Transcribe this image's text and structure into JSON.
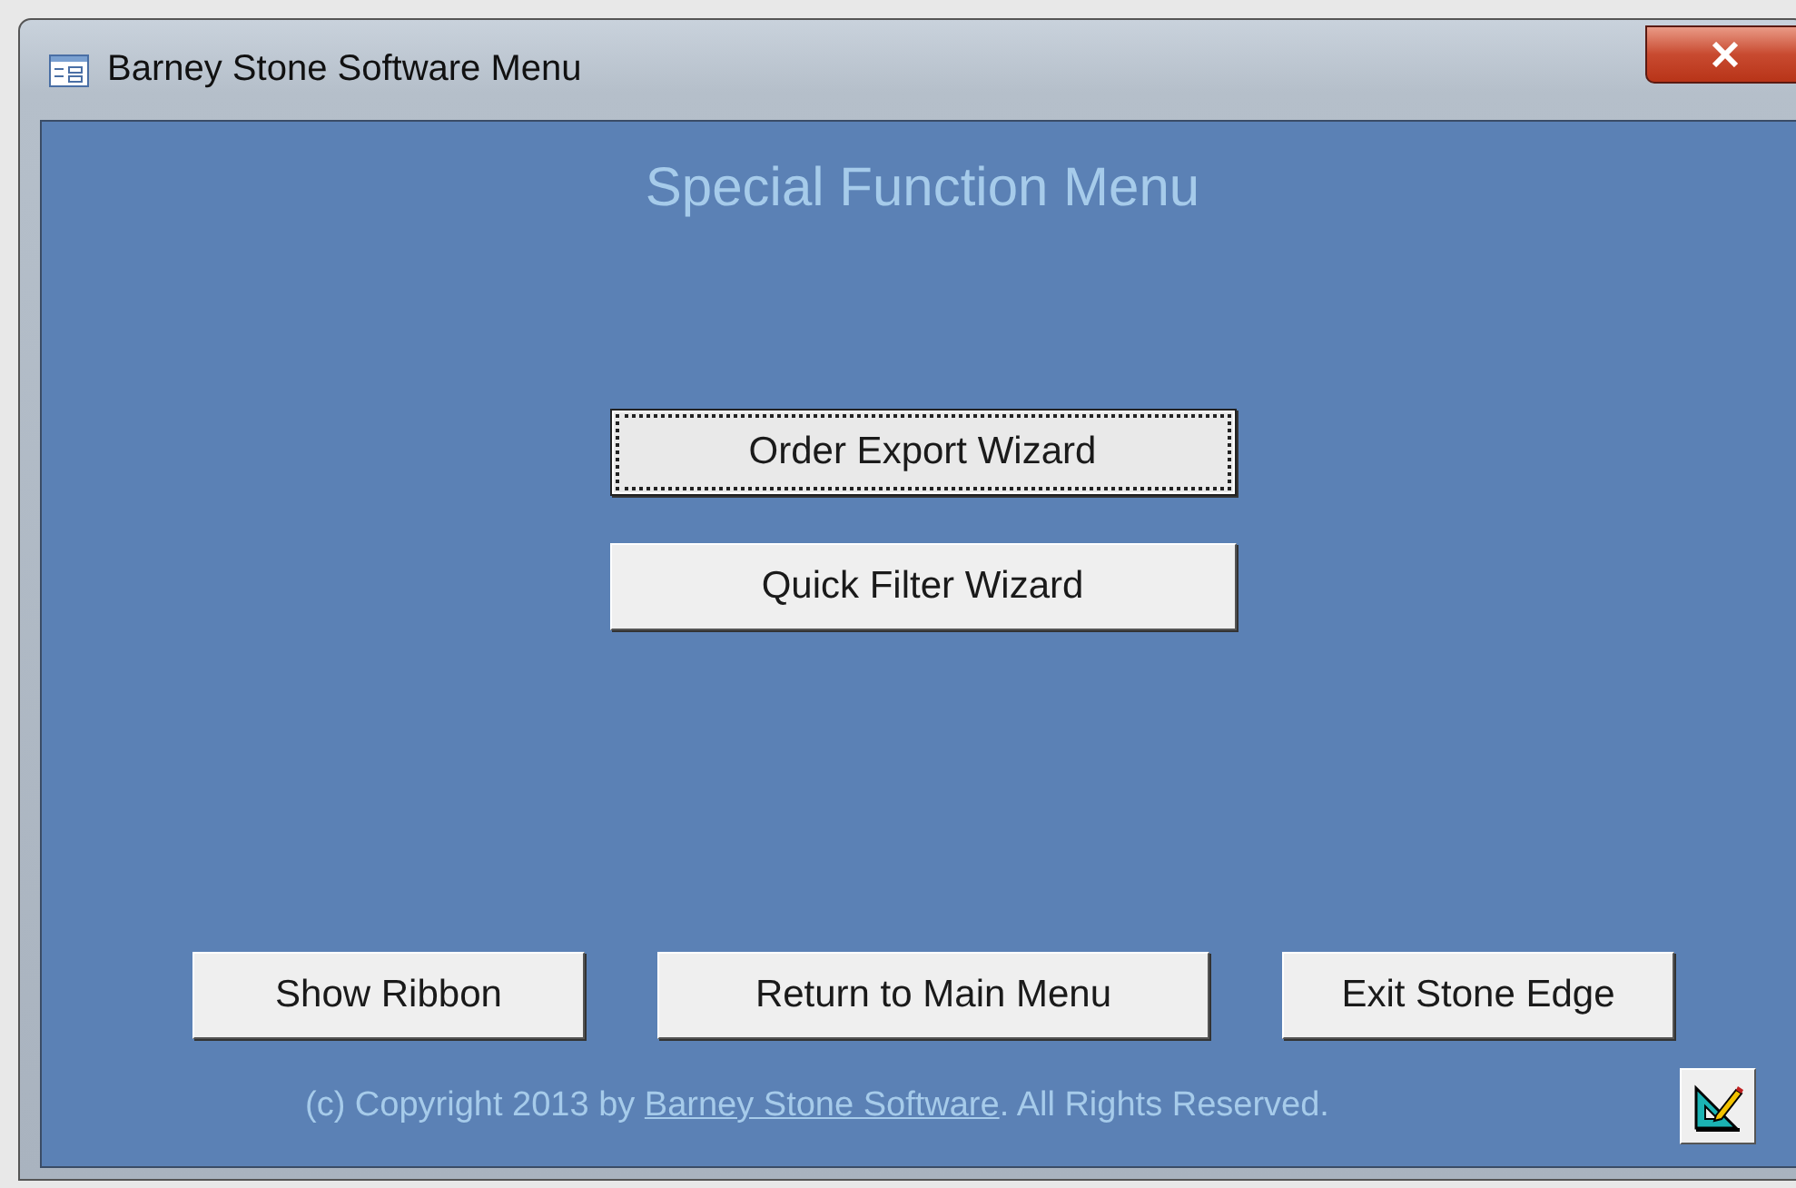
{
  "window": {
    "title": "Barney Stone Software Menu"
  },
  "heading": "Special Function Menu",
  "wizard_buttons": [
    {
      "label": "Order Export Wizard",
      "focused": true
    },
    {
      "label": "Quick Filter Wizard",
      "focused": false
    }
  ],
  "bottom_buttons": [
    {
      "label": "Show Ribbon"
    },
    {
      "label": "Return to Main Menu"
    },
    {
      "label": "Exit Stone Edge"
    }
  ],
  "copyright": {
    "before": "(c) Copyright 2013 by ",
    "link": "Barney Stone Software",
    "after": ". All Rights Reserved."
  }
}
